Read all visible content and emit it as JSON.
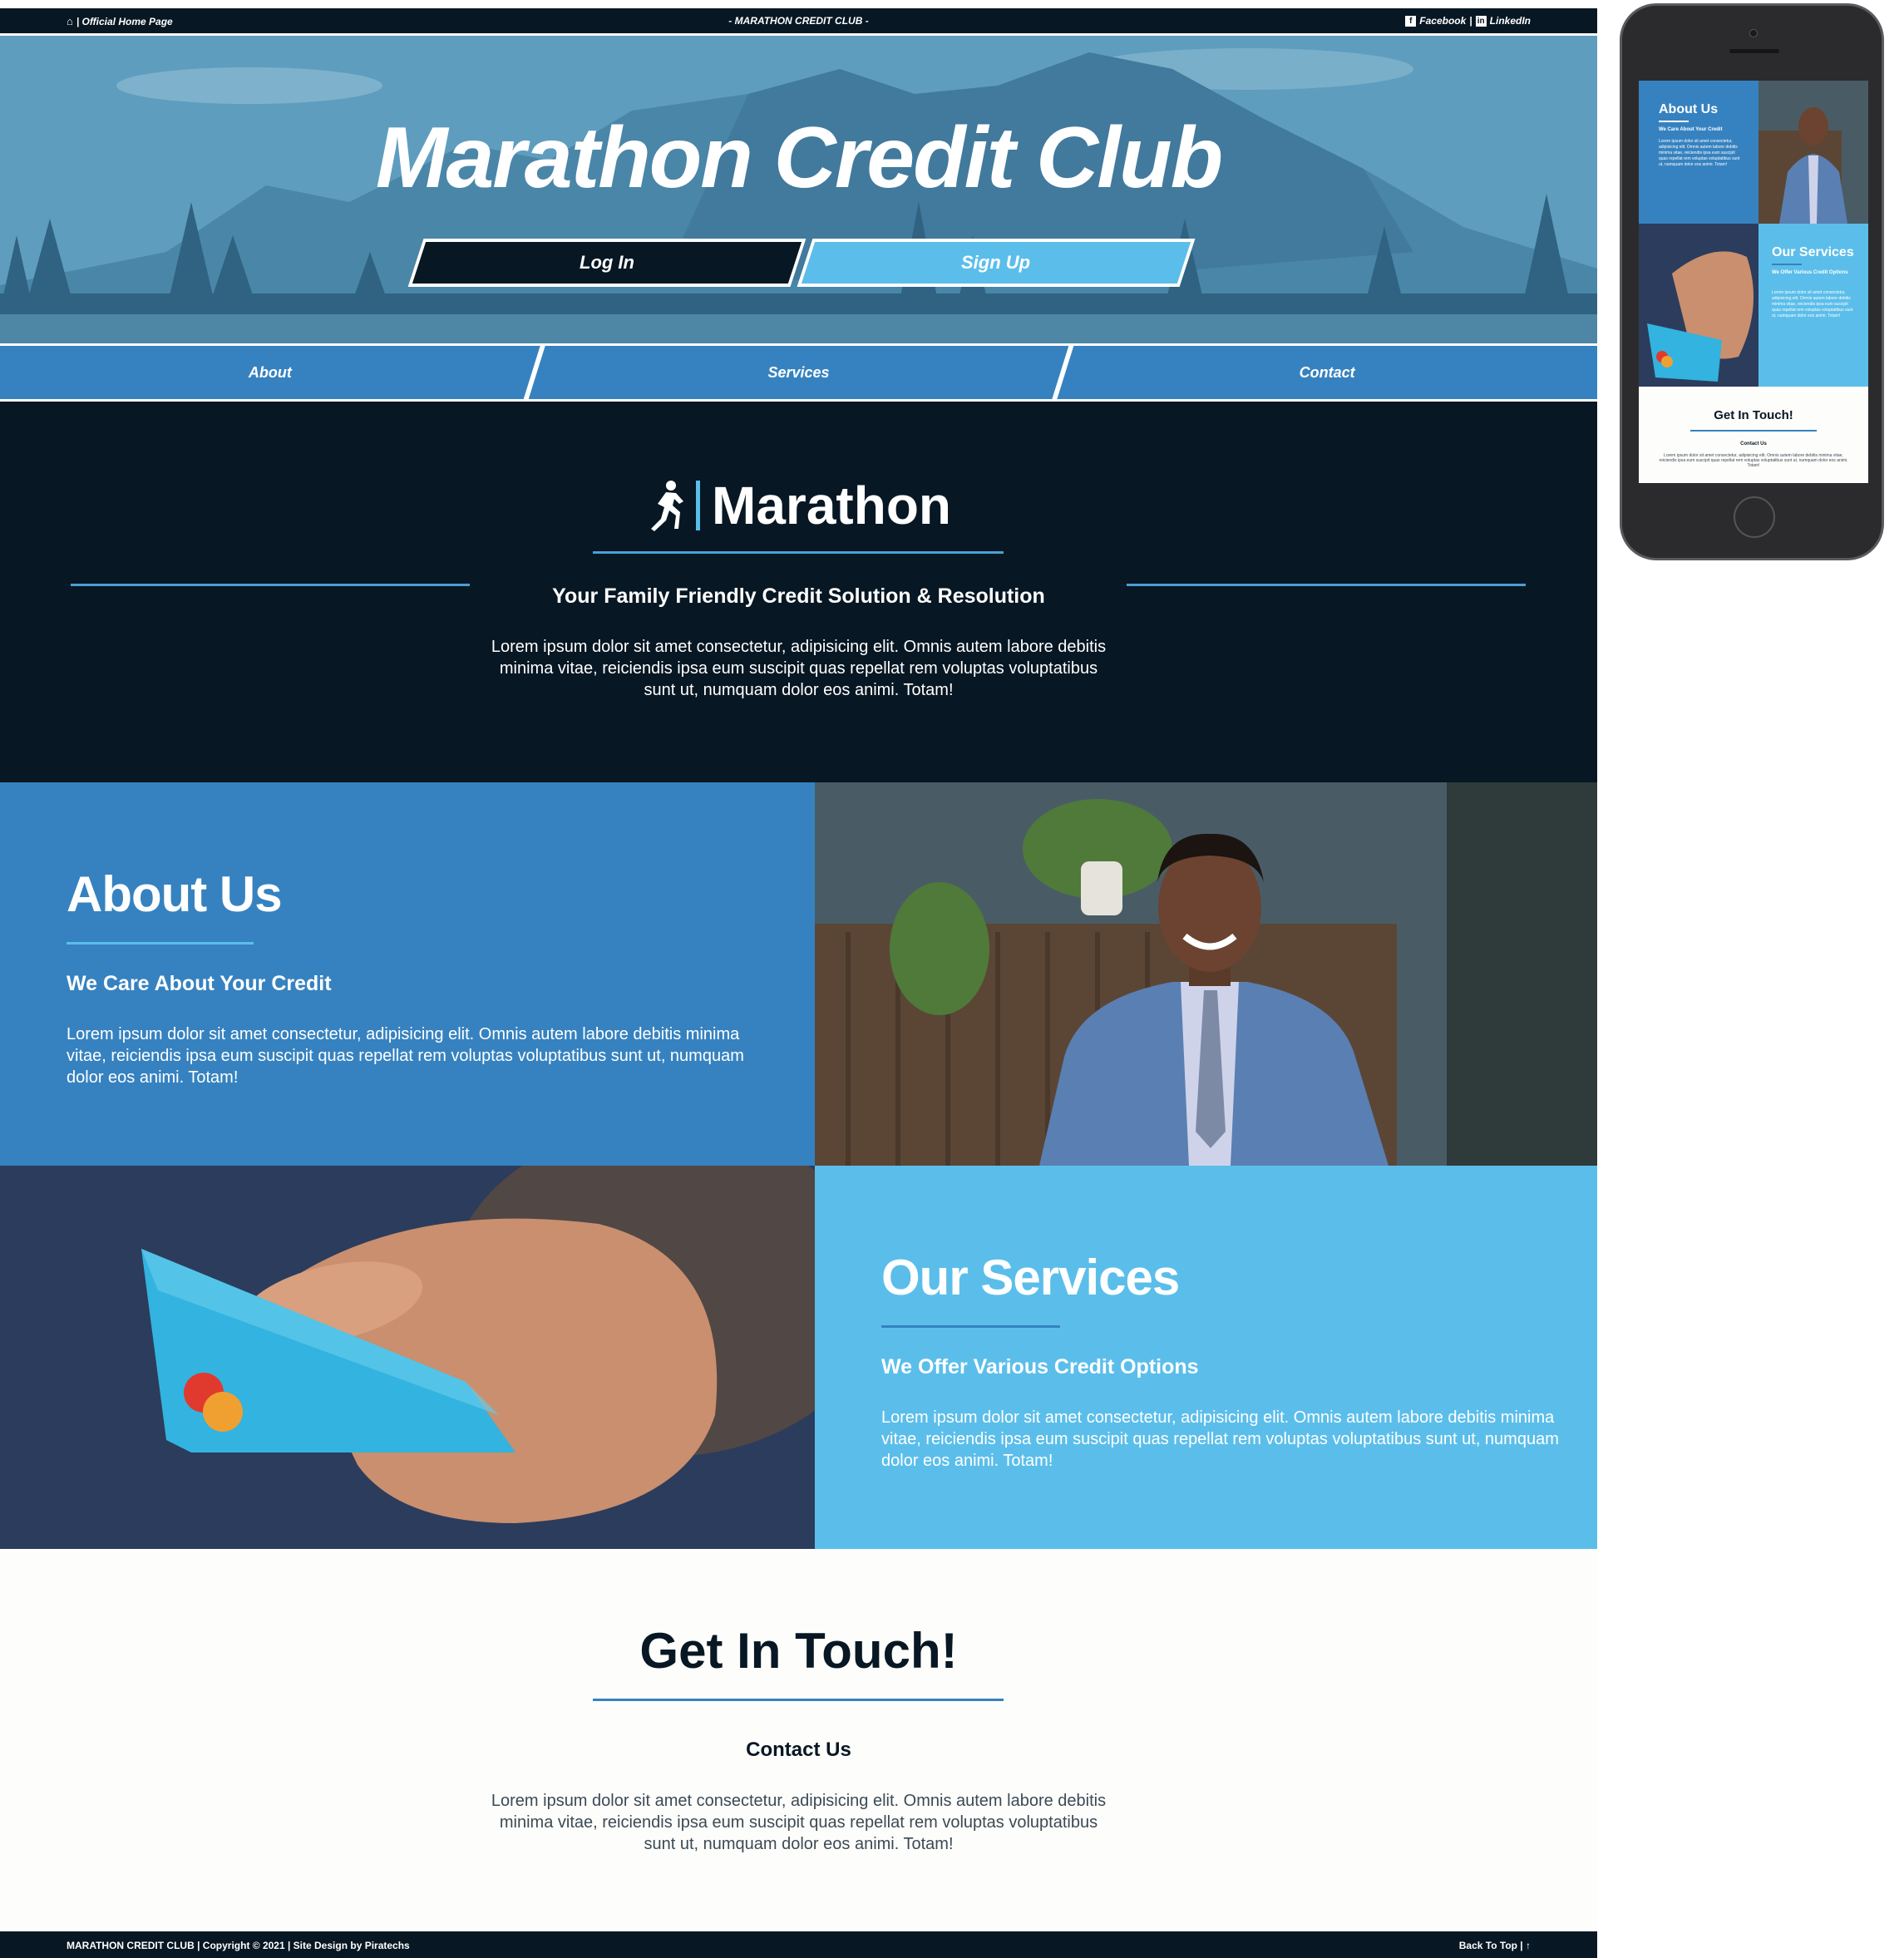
{
  "topbar": {
    "home_label": "| Official Home Page",
    "center_label": "- MARATHON CREDIT CLUB -",
    "facebook_label": "Facebook",
    "separator": "|",
    "linkedin_label": "LinkedIn",
    "home_icon": "home-icon",
    "facebook_icon": "facebook-icon",
    "linkedin_icon": "linkedin-icon"
  },
  "hero": {
    "title": "Marathon Credit Club",
    "login_label": "Log In",
    "signup_label": "Sign Up"
  },
  "nav": {
    "items": [
      "About",
      "Services",
      "Contact"
    ]
  },
  "intro": {
    "brand_name": "Marathon",
    "brand_icon": "runner-icon",
    "tagline": "Your Family Friendly Credit Solution & Resolution",
    "body": "Lorem ipsum dolor sit amet consectetur, adipisicing elit. Omnis autem labore debitis minima vitae, reiciendis ipsa eum suscipit quas repellat rem voluptas voluptatibus sunt ut, numquam dolor eos animi. Totam!"
  },
  "about": {
    "title": "About Us",
    "subtitle": "We Care About Your Credit",
    "body": "Lorem ipsum dolor sit amet consectetur, adipisicing elit. Omnis autem labore debitis minima vitae, reiciendis ipsa eum suscipit quas repellat rem voluptas voluptatibus sunt ut, numquam dolor eos animi. Totam!"
  },
  "services": {
    "title": "Our Services",
    "subtitle": "We Offer Various Credit Options",
    "body": "Lorem ipsum dolor sit amet consectetur, adipisicing elit. Omnis autem labore debitis minima vitae, reiciendis ipsa eum suscipit quas repellat rem voluptas voluptatibus sunt ut, numquam dolor eos animi. Totam!"
  },
  "contact": {
    "title": "Get In Touch!",
    "subtitle": "Contact Us",
    "body": "Lorem ipsum dolor sit amet consectetur, adipisicing elit. Omnis autem labore debitis minima vitae, reiciendis ipsa eum suscipit quas repellat rem voluptas voluptatibus sunt ut, numquam dolor eos animi. Totam!"
  },
  "footer": {
    "left_label": "MARATHON CREDIT CLUB | Copyright © 2021 | Site Design by Piratechs",
    "right_label": "Back To Top | ↑",
    "up_icon": "arrow-up-icon"
  },
  "phone": {
    "about_title": "About Us",
    "about_subtitle": "We Care About Your Credit",
    "about_body": "Lorem ipsum dolor sit amet consectetur, adipisicing elit. Omnis autem labore debitis minima vitae, reiciendis ipsa eum suscipit quas repellat rem voluptas voluptatibus sunt ut, numquam dolor eos animi. Totam!",
    "services_title": "Our Services",
    "services_subtitle": "We Offer Various Credit Options",
    "services_body": "Lorem ipsum dolor sit amet consectetur, adipisicing elit. Omnis autem labore debitis minima vitae, reiciendis ipsa eum suscipit quas repellat rem voluptas voluptatibus sunt ut, numquam dolor eos animi. Totam!",
    "contact_title": "Get In Touch!",
    "contact_subtitle": "Contact Us",
    "contact_body": "Lorem ipsum dolor sit amet consectetur, adipisicing elit. Omnis autem labore debitis minima vitae, reiciendis ipsa eum suscipit quas repellat rem voluptas voluptatibus sunt ut, numquam dolor eos animi. Totam!"
  },
  "colors": {
    "navy": "#071723",
    "blue": "#3682c0",
    "light_blue": "#5bbeea",
    "white": "#ffffff"
  }
}
